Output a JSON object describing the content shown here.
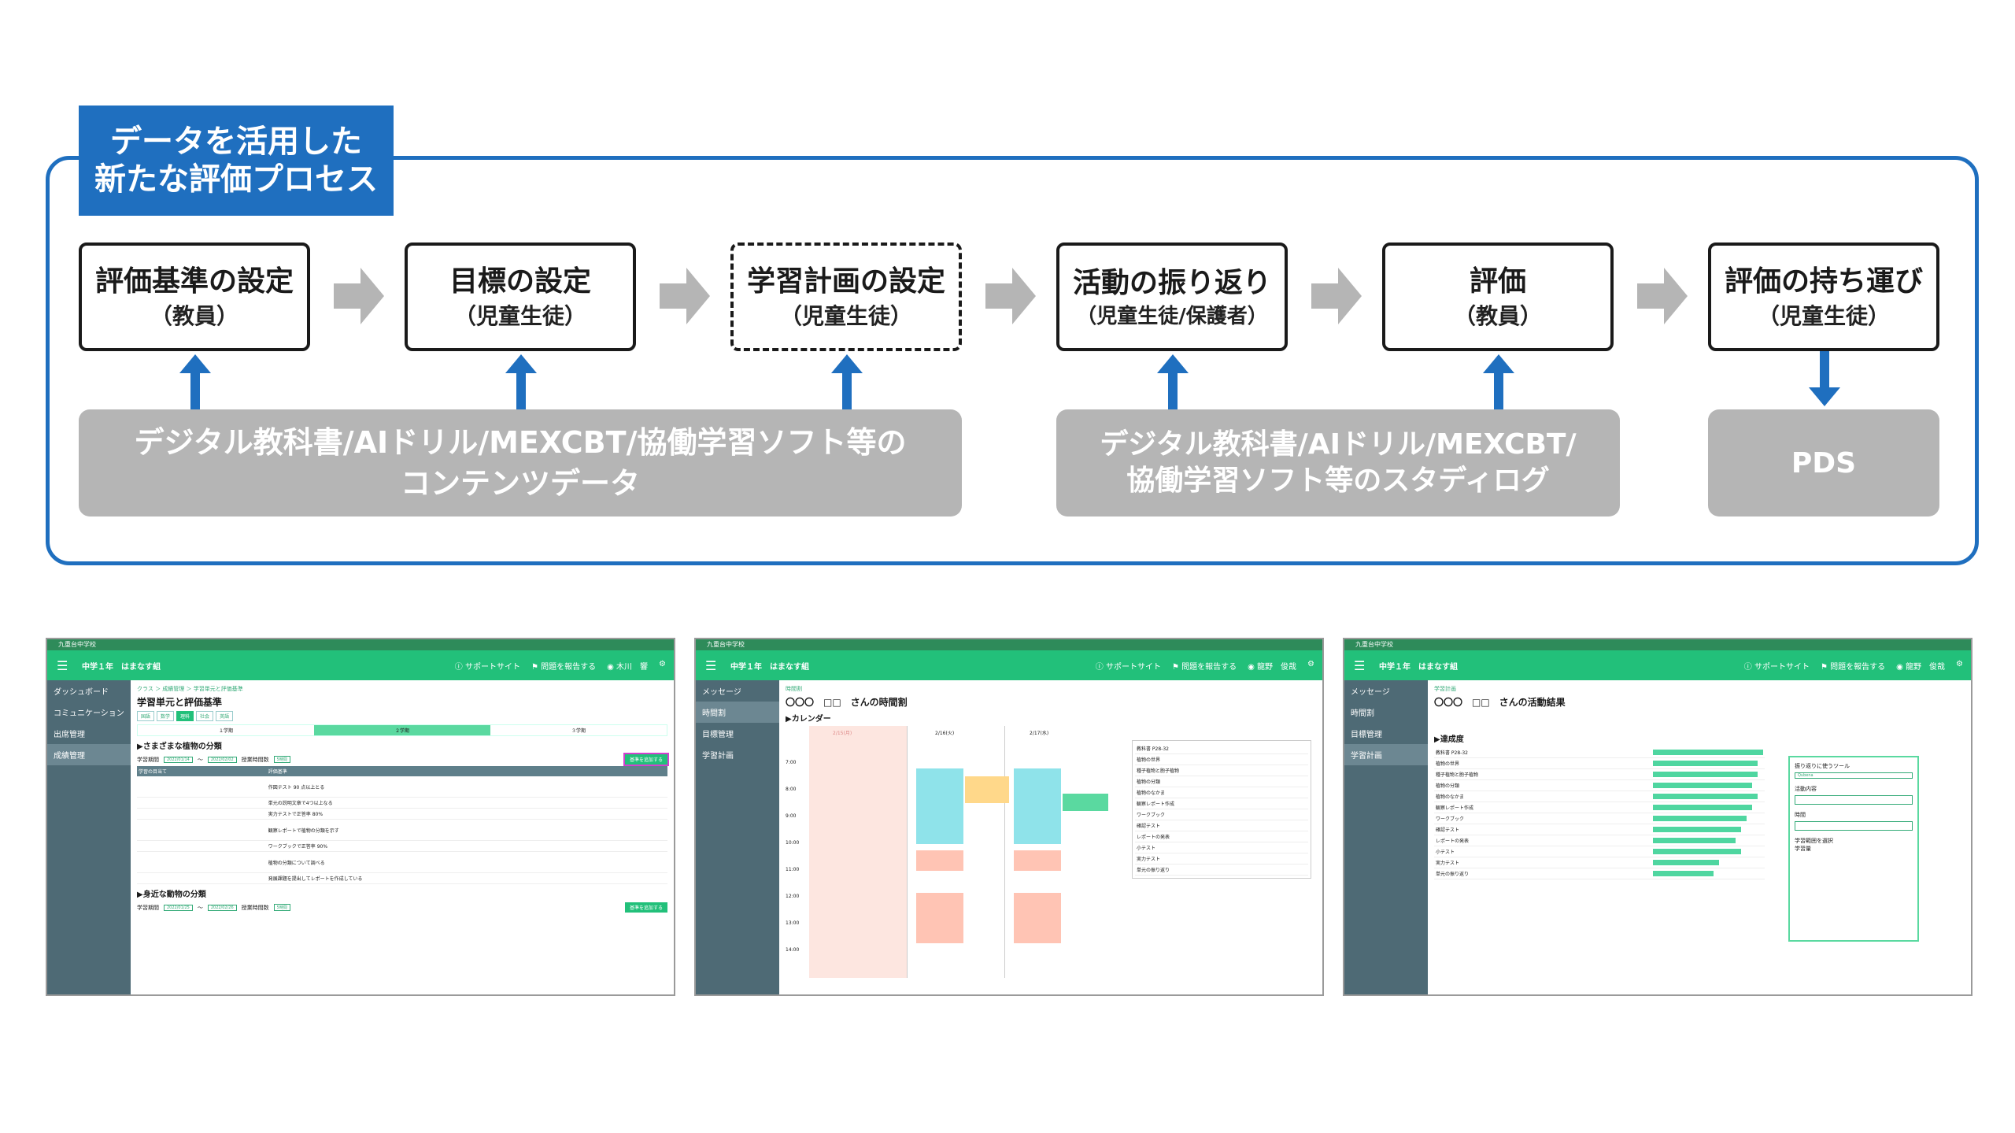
{
  "title": {
    "line1": "データを活用した",
    "line2": "新たな評価プロセス"
  },
  "steps": [
    {
      "label": "評価基準の設定",
      "actor": "（教員）"
    },
    {
      "label": "目標の設定",
      "actor": "（児童生徒）"
    },
    {
      "label": "学習計画の設定",
      "actor": "（児童生徒）"
    },
    {
      "label": "活動の振り返り",
      "actor": "（児童生徒/保護者）"
    },
    {
      "label": "評価",
      "actor": "（教員）"
    },
    {
      "label": "評価の持ち運び",
      "actor": "（児童生徒）"
    }
  ],
  "sources": {
    "content_data": {
      "line1": "デジタル教科書/AIドリル/MEXCBT/協働学習ソフト等の",
      "line2": "コンテンツデータ"
    },
    "study_log": {
      "line1": "デジタル教科書/AIドリル/MEXCBT/",
      "line2": "協働学習ソフト等のスタディログ"
    },
    "pds": "PDS"
  },
  "colors": {
    "frame": "#1f6fbf",
    "gray": "#b5b5b5",
    "app_green": "#22c07a",
    "sidebar": "#4e6a75"
  },
  "shot1": {
    "school": "九重台中学校",
    "grade": "中学１年　はまなす組",
    "support": "サポートサイト",
    "report": "問題を報告する",
    "user": "木川　響",
    "sidebar": [
      "ダッシュボード",
      "コミュニケーション",
      "出席管理",
      "成績管理"
    ],
    "breadcrumb": "クラス ＞ 成績管理 ＞ 学習単元と評価基準",
    "page_title": "学習単元と評価基準",
    "subjects": [
      "国語",
      "数学",
      "理科",
      "社会",
      "英語"
    ],
    "terms": [
      "１学期",
      "２学期",
      "３学期"
    ],
    "unit1": "▶さまざまな植物の分類",
    "unit2": "▶身近な動物の分類",
    "period_label": "学習期間",
    "date1": "2022/01/14",
    "date2": "2022/02/02",
    "date3": "2022/01/25",
    "date4": "2022/02/26",
    "hours_label": "授業時間数",
    "hours": "5時間",
    "criteria_button": "基準を追加する",
    "goal_header": "学習の目当て",
    "eval_header": "評価基準",
    "tasks": [
      "作図テスト 90 点以上とる",
      "単元の説明文章で4つ以上なる",
      "実力テストで正答率 80%",
      "観察レポートで植物の分類を示す",
      "ワークブックで正答率 90%",
      "植物の分類について調べる",
      "発展課題を提出してレポートを作成している"
    ]
  },
  "shot2": {
    "school": "九重台中学校",
    "grade": "中学１年　はまなす組",
    "support": "サポートサイト",
    "report": "問題を報告する",
    "user": "龍野　俊哉",
    "sidebar": [
      "メッセージ",
      "時間割",
      "目標管理",
      "学習計画"
    ],
    "breadcrumb": "時間割",
    "page_title": "〇〇〇　□□　さんの時間割",
    "calendar_label": "▶カレンダー",
    "days": [
      "2/15(月)",
      "2/16(火)",
      "2/17(水)"
    ],
    "times": [
      "7:00",
      "8:00",
      "9:00",
      "10:00",
      "11:00",
      "12:00",
      "13:00",
      "14:00"
    ],
    "tasks": [
      "教科書 P28-32",
      "植物の世界",
      "種子植物と胞子植物",
      "植物の分類",
      "植物のなかま",
      "観察レポート作成",
      "ワークブック",
      "確認テスト",
      "レポートの発表",
      "小テスト",
      "実力テスト",
      "単元の振り返り"
    ]
  },
  "shot3": {
    "school": "九重台中学校",
    "grade": "中学１年　はまなす組",
    "support": "サポートサイト",
    "report": "問題を報告する",
    "user": "龍野　俊哉",
    "sidebar": [
      "メッセージ",
      "時間割",
      "目標管理",
      "学習計画"
    ],
    "breadcrumb": "学習計画",
    "page_title": "〇〇〇　□□　さんの活動結果",
    "achievement": "▶達成度",
    "reflect_tool": "振り返りに使うツール",
    "tool_value": "Qubena",
    "activity": "活動内容",
    "time": "時間",
    "scope": "学習範囲を選択",
    "amount": "学習量",
    "tasks": [
      "教科書 P28-32",
      "植物の世界",
      "種子植物と胞子植物",
      "植物の分類",
      "植物のなかま",
      "観察レポート作成",
      "ワークブック",
      "確認テスト",
      "レポートの発表",
      "小テスト",
      "実力テスト",
      "単元の振り返り"
    ],
    "progress": [
      1.0,
      0.95,
      0.95,
      0.9,
      0.95,
      0.9,
      0.85,
      0.8,
      0.75,
      0.8,
      0.6,
      0.55
    ]
  }
}
